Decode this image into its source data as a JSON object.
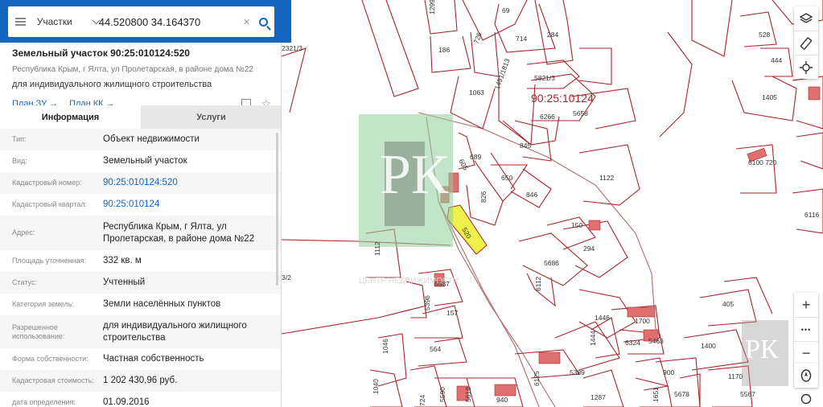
{
  "search": {
    "layer": "Участки",
    "query": "44.520800 34.164370",
    "clear": "×"
  },
  "parcel": {
    "title": "Земельный участок 90:25:010124:520",
    "address": "Республика Крым, г Ялта, ул Пролетарская, в районе дома №22",
    "use": "для индивидуального жилищного строительства",
    "plan_zu": "План ЗУ →",
    "plan_kk": "План КК →"
  },
  "tabs": [
    {
      "label": "Информация"
    },
    {
      "label": "Услуги"
    }
  ],
  "rows": [
    {
      "label": "Тип:",
      "value": "Объект недвижимости"
    },
    {
      "label": "Вид:",
      "value": "Земельный участок"
    },
    {
      "label": "Кадастровый номер:",
      "value": "90:25:010124:520"
    },
    {
      "label": "Кадастровый квартал:",
      "value": "90:25:010124"
    },
    {
      "label": "Адрес:",
      "value": "Республика Крым, г Ялта, ул Пролетарская, в районе дома №22"
    },
    {
      "label": "Площадь уточненная:",
      "value": "332 кв. м"
    },
    {
      "label": "Статус:",
      "value": "Учтенный"
    },
    {
      "label": "Категория земель:",
      "value": "Земли населённых пунктов"
    },
    {
      "label": "Разрешенное использование:",
      "value": "для индивидуального жилищного строительства"
    },
    {
      "label": "Форма собственности:",
      "value": "Частная собственность"
    },
    {
      "label": "Кадастровая стоимость:",
      "value": "1 202 430,96 руб."
    },
    {
      "label": "дата определения:",
      "value": "01.09.2016"
    }
  ],
  "map": {
    "quarter_label": "90:25:10124",
    "parcel_labels": [
      "1299",
      "69",
      "714",
      "284",
      "528",
      "444",
      "186",
      "726",
      "5821/3",
      "1063",
      "1491/1813",
      "6266",
      "5658",
      "1405",
      "689",
      "845",
      "650",
      "846",
      "826",
      "1122",
      "6100 720",
      "6116",
      "150",
      "294",
      "5686",
      "520",
      "605",
      "1112",
      "6112",
      "5537",
      "5396",
      "157",
      "1446",
      "1444",
      "1700",
      "6324",
      "5463",
      "405",
      "1400",
      "564",
      "1046",
      "5389",
      "900",
      "1170",
      "724",
      "5590",
      "5618",
      "940",
      "1287",
      "1651",
      "5678",
      "5567",
      "2321/3",
      "3/2",
      "1040",
      "6125"
    ],
    "watermark_letters": "РК",
    "watermark_text": "ЦЕНТР НЕДВИЖИМОСТИ"
  },
  "controls": {
    "zoom_in": "+",
    "more": "•••",
    "zoom_out": "−"
  },
  "colors": {
    "accent": "#1565c0",
    "boundary": "#a8252b",
    "building": "#e07070",
    "selected": "#f0f04a",
    "watermark": "#8fcf9c"
  }
}
